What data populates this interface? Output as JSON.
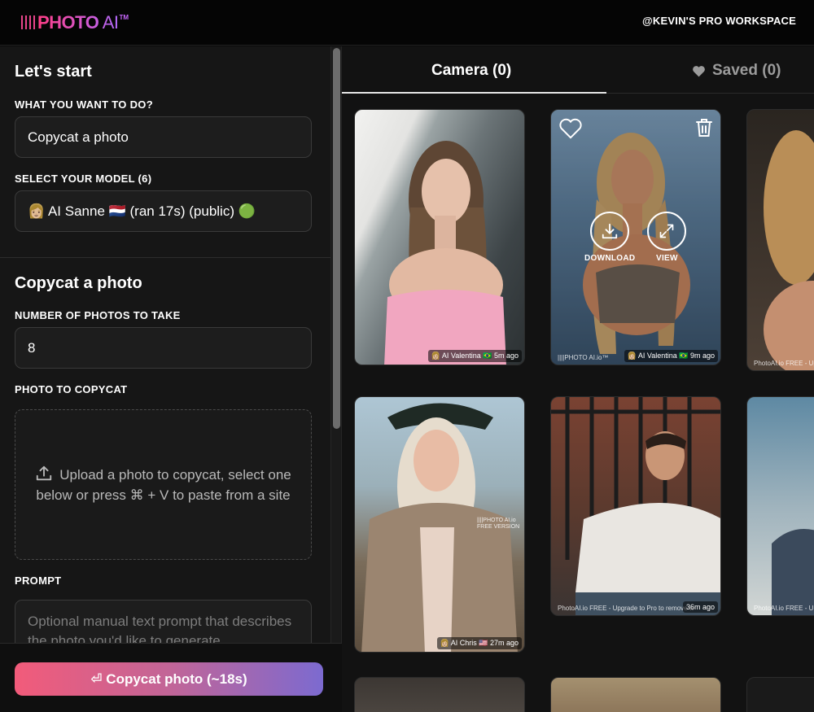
{
  "header": {
    "logo_main": "PHOTO",
    "logo_ai": " AI",
    "logo_tm": "TM",
    "workspace": "@KEVIN'S PRO WORKSPACE"
  },
  "left": {
    "start_title": "Let's start",
    "what_label": "WHAT YOU WANT TO DO?",
    "what_value": "Copycat a photo",
    "model_label": "SELECT YOUR MODEL (6)",
    "model_value": "👩🏼 AI Sanne 🇳🇱 (ran 17s) (public) 🟢",
    "copycat_title": "Copycat a photo",
    "count_label": "NUMBER OF PHOTOS TO TAKE",
    "count_value": "8",
    "photo_label": "PHOTO TO COPYCAT",
    "dropzone_line1": "Upload a photo to copycat, select one",
    "dropzone_line2": "below or press ⌘ + V to paste from a site",
    "prompt_label": "PROMPT",
    "prompt_placeholder": "Optional manual text prompt that describes the photo you'd like to generate",
    "cta_label": "⏎ Copycat photo (~18s)"
  },
  "tabs": {
    "camera": "Camera (0)",
    "saved": "Saved (0)"
  },
  "gallery": {
    "card1_badge": "👩🏼 AI Valentina 🇧🇷 5m ago",
    "card2_badge": "👩🏼 AI Valentina 🇧🇷 9m ago",
    "card2_wm": "||||PHOTO AI.io™",
    "download": "DOWNLOAD",
    "view": "VIEW",
    "card3_wm": "PhotoAI.io FREE - Upgr",
    "card4_badge": "👩🏼 AI Chris 🇺🇸 27m ago",
    "card4_wm": "||||PHOTO AI.io FREE VERSION",
    "card5_badge": "36m ago",
    "card5_wm": "PhotoAI.io FREE - Upgrade to Pro to remove w",
    "card6_wm": "PhotoAI.io FREE - U"
  },
  "colors": {
    "accent_pink": "#ff3d86",
    "accent_purple": "#7c6ad0"
  }
}
